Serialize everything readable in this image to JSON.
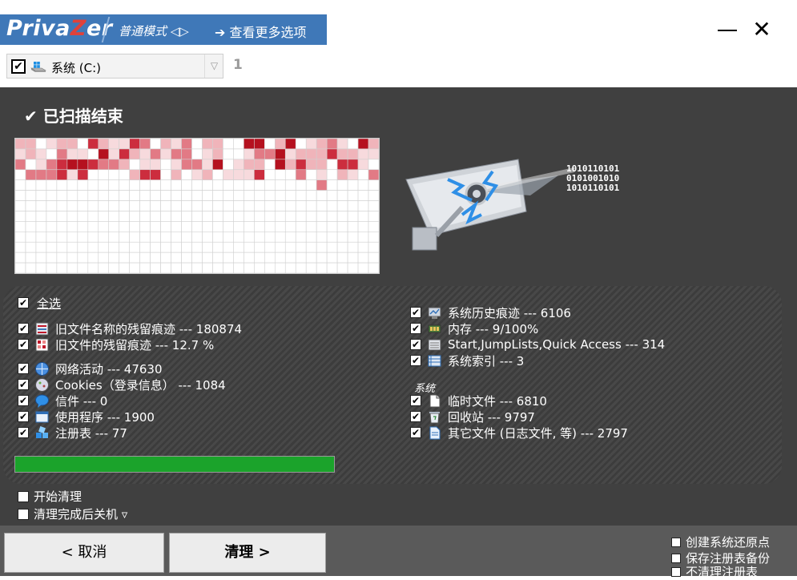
{
  "header": {
    "logo": "PrivaZer",
    "mode": "普通模式 ◁▷",
    "more_options": "➔ 查看更多选项"
  },
  "window_controls": {
    "minimize": "minimize",
    "close": "✕"
  },
  "drive": {
    "checked": true,
    "label": "系统 (C:)",
    "count": "1"
  },
  "scan": {
    "status": "已扫描结束"
  },
  "select_all": {
    "checked": true,
    "label": "全选"
  },
  "left_groups": [
    [
      {
        "icon": "list-icon",
        "label": "旧文件名称的残留痕迹 ---  180874",
        "checked": true
      },
      {
        "icon": "grid-icon",
        "label": "旧文件的残留痕迹 ---  12.7 %",
        "checked": true
      }
    ],
    [
      {
        "icon": "network-icon",
        "label": "网络活动 ---  47630",
        "checked": true
      },
      {
        "icon": "cookie-icon",
        "label": "Cookies（登录信息） --- 1084",
        "checked": true
      },
      {
        "icon": "chat-icon",
        "label": "信件 --- 0",
        "checked": true
      },
      {
        "icon": "window-icon",
        "label": "使用程序 ---  1900",
        "checked": true
      },
      {
        "icon": "registry-icon",
        "label": "注册表 --- 77",
        "checked": true
      }
    ]
  ],
  "right_top": [
    {
      "icon": "history-icon",
      "label": "系统历史痕迹 --- 6106",
      "checked": true
    },
    {
      "icon": "memory-icon",
      "label": "内存 --- 9/100%",
      "checked": true
    },
    {
      "icon": "jumplist-icon",
      "label": "Start,JumpLists,Quick Access --- 314",
      "checked": true
    },
    {
      "icon": "index-icon",
      "label": "系统索引 --- 3",
      "checked": true
    }
  ],
  "system_section_label": "系统",
  "right_bottom": [
    {
      "icon": "temp-file-icon",
      "label": "临时文件 --- 6810",
      "checked": true
    },
    {
      "icon": "recycle-bin-icon",
      "label": "回收站 --- 9797",
      "checked": true
    },
    {
      "icon": "other-file-icon",
      "label": "其它文件 (日志文件, 等) --- 2797",
      "checked": true
    }
  ],
  "progress": {
    "value": 1.0,
    "color": "#1ba32b"
  },
  "options": {
    "start_clean": "开始清理",
    "shutdown_after": "清理完成后关机 ▿"
  },
  "buttons": {
    "cancel": "< 取消",
    "clean": "清理 >"
  },
  "right_options": [
    "创建系统还原点",
    "保存注册表备份",
    "不清理注册表"
  ],
  "colors": {
    "accent": "#3f78b8",
    "panel": "#404040",
    "heat_dark": "#c0182a",
    "heat_light": "#f5d2d6"
  }
}
